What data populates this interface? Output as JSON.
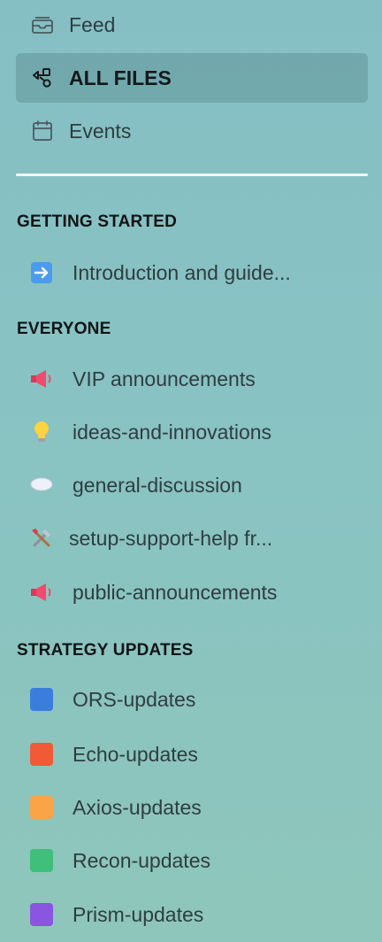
{
  "nav": {
    "feed": {
      "label": "Feed",
      "icon": "inbox-icon"
    },
    "all_files": {
      "label": "ALL FILES",
      "icon": "shapes-icon"
    },
    "events": {
      "label": "Events",
      "icon": "calendar-icon"
    }
  },
  "sections": {
    "getting_started": {
      "title": "GETTING STARTED",
      "channels": [
        {
          "label": "Introduction and guide...",
          "icon": "arrow-right-emoji"
        }
      ]
    },
    "everyone": {
      "title": "EVERYONE",
      "channels": [
        {
          "label": "VIP announcements",
          "icon": "megaphone-emoji"
        },
        {
          "label": "ideas-and-innovations",
          "icon": "lightbulb-emoji"
        },
        {
          "label": "general-discussion",
          "icon": "speech-bubble-emoji"
        },
        {
          "label": "setup-support-help fr...",
          "icon": "tools-emoji"
        },
        {
          "label": "public-announcements",
          "icon": "megaphone-emoji"
        }
      ]
    },
    "strategy_updates": {
      "title": "STRATEGY UPDATES",
      "channels": [
        {
          "label": "ORS-updates",
          "icon": "blue-square",
          "color": "#3b7ddd"
        },
        {
          "label": "Echo-updates",
          "icon": "red-orange-square",
          "color": "#f05a36"
        },
        {
          "label": "Axios-updates",
          "icon": "orange-square",
          "color": "#fba347"
        },
        {
          "label": "Recon-updates",
          "icon": "green-square",
          "color": "#3fbf7a"
        },
        {
          "label": "Prism-updates",
          "icon": "purple-square",
          "color": "#8a55e0"
        }
      ]
    }
  }
}
